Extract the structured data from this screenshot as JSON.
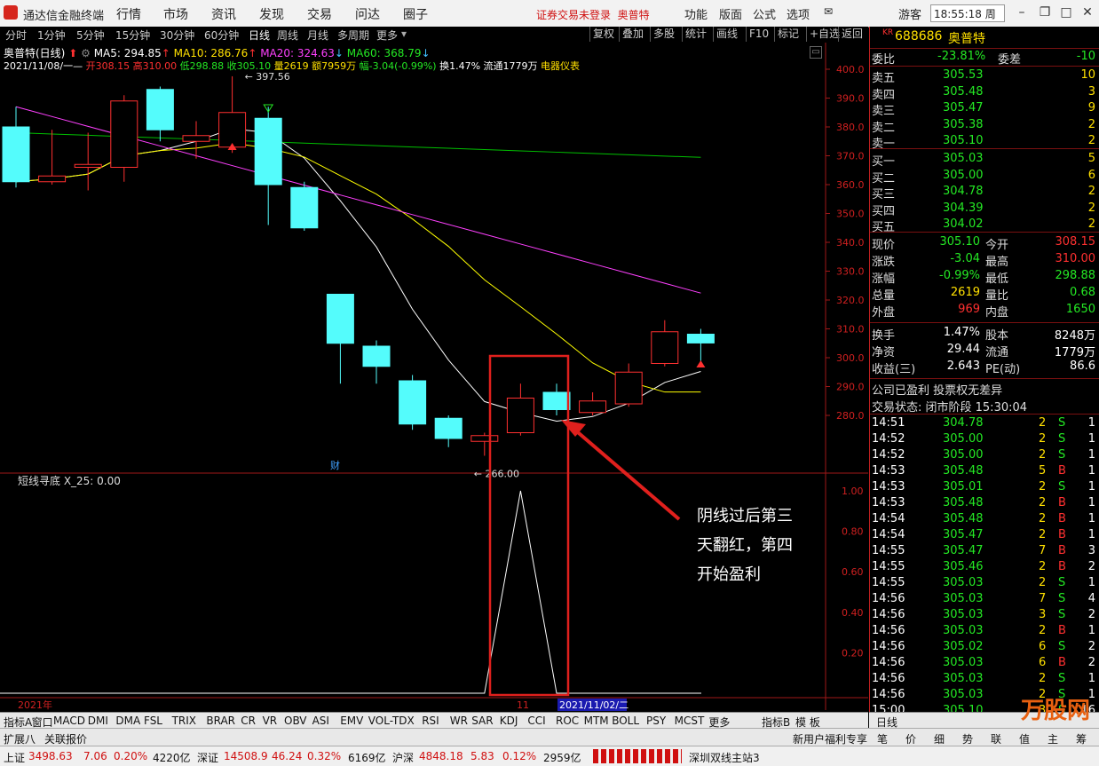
{
  "menubar": {
    "app_title": "通达信金融终端",
    "items": [
      "行情",
      "市场",
      "资讯",
      "发现",
      "交易",
      "问达",
      "圈子"
    ],
    "warning": "证券交易未登录",
    "stock_short": "奥普特",
    "right_items": [
      "功能",
      "版面",
      "公式",
      "选项"
    ],
    "user": "游客",
    "clock": "18:55:18 周一"
  },
  "periods": [
    "分时",
    "1分钟",
    "5分钟",
    "15分钟",
    "30分钟",
    "60分钟",
    "日线",
    "周线",
    "月线",
    "多周期",
    "更多"
  ],
  "active_period": "日线",
  "tool_buttons": [
    "复权",
    "叠加",
    "多股",
    "统计",
    "画线",
    "F10",
    "标记",
    "+自选",
    "返回"
  ],
  "chart_header": {
    "name": "奥普特(日线)",
    "ma5": "MA5: 294.85",
    "ma10": "MA10: 286.76",
    "ma20": "MA20: 324.63",
    "ma60": "MA60: 368.79",
    "line2_date": "2021/11/08/一",
    "line2_open": "开308.15",
    "line2_high": "高310.00",
    "line2_low": "低298.88",
    "line2_close": "收305.10",
    "line2_vol": "量2619",
    "line2_amt": "额7959万",
    "line2_chg": "幅-3.04(-0.99%)",
    "line2_turn": "换1.47%",
    "line2_float": "流通1779万",
    "line2_sector": "电器仪表"
  },
  "price_axis": [
    "400.0",
    "390.0",
    "380.0",
    "370.0",
    "360.0",
    "350.0",
    "340.0",
    "330.0",
    "320.0",
    "310.0",
    "300.0",
    "290.0",
    "280.0"
  ],
  "high_label": "397.56",
  "low_label": "266.00",
  "cai_label": "财",
  "indicator": {
    "title": "短线寻底 X_25: 0.00",
    "axis": [
      "1.00",
      "0.80",
      "0.60",
      "0.40",
      "0.20"
    ]
  },
  "date_axis": {
    "start": "2021年",
    "mid": "11",
    "cursor": "2021/11/02/二"
  },
  "annotation": {
    "line1": "阴线过后第三",
    "line2": "天翻红，第四",
    "line3": "开始盈利"
  },
  "chart_data": {
    "type": "candlestick",
    "candles": [
      {
        "o": 380.0,
        "h": 387.0,
        "l": 359.0,
        "c": 361.0
      },
      {
        "o": 361.0,
        "h": 379.0,
        "l": 360.0,
        "c": 363.0
      },
      {
        "o": 366.0,
        "h": 378.0,
        "l": 358.0,
        "c": 367.0
      },
      {
        "o": 366.0,
        "h": 391.0,
        "l": 361.0,
        "c": 389.0
      },
      {
        "o": 393.0,
        "h": 394.0,
        "l": 375.0,
        "c": 379.0
      },
      {
        "o": 375.0,
        "h": 382.0,
        "l": 369.0,
        "c": 377.0
      },
      {
        "o": 373.0,
        "h": 397.56,
        "l": 371.0,
        "c": 385.0
      },
      {
        "o": 383.0,
        "h": 387.0,
        "l": 346.0,
        "c": 360.0
      },
      {
        "o": 359.0,
        "h": 361.0,
        "l": 344.0,
        "c": 345.0
      },
      {
        "o": 322.0,
        "h": 322.0,
        "l": 291.0,
        "c": 305.0
      },
      {
        "o": 304.0,
        "h": 306.0,
        "l": 291.0,
        "c": 297.0
      },
      {
        "o": 292.0,
        "h": 294.0,
        "l": 275.0,
        "c": 277.0
      },
      {
        "o": 279.0,
        "h": 280.0,
        "l": 269.0,
        "c": 272.0
      },
      {
        "o": 271.0,
        "h": 274.0,
        "l": 266.0,
        "c": 273.0
      },
      {
        "o": 274.0,
        "h": 291.0,
        "l": 273.0,
        "c": 286.0
      },
      {
        "o": 288.0,
        "h": 291.0,
        "l": 280.0,
        "c": 282.0
      },
      {
        "o": 281.0,
        "h": 288.0,
        "l": 280.0,
        "c": 285.0
      },
      {
        "o": 284.0,
        "h": 298.0,
        "l": 283.0,
        "c": 295.0
      },
      {
        "o": 298.0,
        "h": 313.0,
        "l": 297.0,
        "c": 309.0
      },
      {
        "o": 308.15,
        "h": 310.0,
        "l": 298.88,
        "c": 305.1
      }
    ],
    "ylim": [
      266,
      402
    ],
    "indicator_values": [
      0,
      0,
      0,
      0,
      0,
      0,
      0,
      0,
      0,
      0,
      0,
      0,
      0,
      0,
      1,
      0,
      0,
      0,
      0,
      0
    ]
  },
  "quote": {
    "code_prefix": "KR",
    "code": "688686",
    "name": "奥普特",
    "weibi_label": "委比",
    "weibi": "-23.81%",
    "weicha_label": "委差",
    "weicha": "-10",
    "asks": [
      {
        "label": "卖五",
        "price": "305.53",
        "vol": "10"
      },
      {
        "label": "卖四",
        "price": "305.48",
        "vol": "3"
      },
      {
        "label": "卖三",
        "price": "305.47",
        "vol": "9"
      },
      {
        "label": "卖二",
        "price": "305.38",
        "vol": "2"
      },
      {
        "label": "卖一",
        "price": "305.10",
        "vol": "2"
      }
    ],
    "bids": [
      {
        "label": "买一",
        "price": "305.03",
        "vol": "5"
      },
      {
        "label": "买二",
        "price": "305.00",
        "vol": "6"
      },
      {
        "label": "买三",
        "price": "304.78",
        "vol": "2"
      },
      {
        "label": "买四",
        "price": "304.39",
        "vol": "2"
      },
      {
        "label": "买五",
        "price": "304.02",
        "vol": "2"
      }
    ],
    "stats": [
      {
        "l1": "现价",
        "v1": "305.10",
        "c1": "grn",
        "l2": "今开",
        "v2": "308.15",
        "c2": "red"
      },
      {
        "l1": "涨跌",
        "v1": "-3.04",
        "c1": "grn",
        "l2": "最高",
        "v2": "310.00",
        "c2": "red"
      },
      {
        "l1": "涨幅",
        "v1": "-0.99%",
        "c1": "grn",
        "l2": "最低",
        "v2": "298.88",
        "c2": "grn"
      },
      {
        "l1": "总量",
        "v1": "2619",
        "c1": "yel",
        "l2": "量比",
        "v2": "0.68",
        "c2": "grn"
      },
      {
        "l1": "外盘",
        "v1": "969",
        "c1": "red",
        "l2": "内盘",
        "v2": "1650",
        "c2": "grn"
      }
    ],
    "stats2": [
      {
        "l1": "换手",
        "v1": "1.47%",
        "l2": "股本",
        "v2": "8248万"
      },
      {
        "l1": "净资",
        "v1": "29.44",
        "l2": "流通",
        "v2": "1779万"
      },
      {
        "l1": "收益(三)",
        "v1": "2.643",
        "l2": "PE(动)",
        "v2": "86.6"
      }
    ],
    "company_status": "公司已盈利 投票权无差异",
    "trade_status": "交易状态: 闭市阶段 15:30:04"
  },
  "ticks": [
    {
      "t": "14:51",
      "p": "304.78",
      "v": "2",
      "s": "S",
      "n": "1"
    },
    {
      "t": "14:52",
      "p": "305.00",
      "v": "2",
      "s": "S",
      "n": "1"
    },
    {
      "t": "14:52",
      "p": "305.00",
      "v": "2",
      "s": "S",
      "n": "1"
    },
    {
      "t": "14:53",
      "p": "305.48",
      "v": "5",
      "s": "B",
      "n": "1"
    },
    {
      "t": "14:53",
      "p": "305.01",
      "v": "2",
      "s": "S",
      "n": "1"
    },
    {
      "t": "14:53",
      "p": "305.48",
      "v": "2",
      "s": "B",
      "n": "1"
    },
    {
      "t": "14:54",
      "p": "305.48",
      "v": "2",
      "s": "B",
      "n": "1"
    },
    {
      "t": "14:54",
      "p": "305.47",
      "v": "2",
      "s": "B",
      "n": "1"
    },
    {
      "t": "14:55",
      "p": "305.47",
      "v": "7",
      "s": "B",
      "n": "3"
    },
    {
      "t": "14:55",
      "p": "305.46",
      "v": "2",
      "s": "B",
      "n": "2"
    },
    {
      "t": "14:55",
      "p": "305.03",
      "v": "2",
      "s": "S",
      "n": "1"
    },
    {
      "t": "14:56",
      "p": "305.03",
      "v": "7",
      "s": "S",
      "n": "4"
    },
    {
      "t": "14:56",
      "p": "305.03",
      "v": "3",
      "s": "S",
      "n": "2"
    },
    {
      "t": "14:56",
      "p": "305.03",
      "v": "2",
      "s": "B",
      "n": "1"
    },
    {
      "t": "14:56",
      "p": "305.02",
      "v": "6",
      "s": "S",
      "n": "2"
    },
    {
      "t": "14:56",
      "p": "305.03",
      "v": "6",
      "s": "B",
      "n": "2"
    },
    {
      "t": "14:56",
      "p": "305.03",
      "v": "2",
      "s": "S",
      "n": "1"
    },
    {
      "t": "14:56",
      "p": "305.03",
      "v": "2",
      "s": "S",
      "n": "1"
    },
    {
      "t": "15:00",
      "p": "305.10",
      "v": "3",
      "s": "S",
      "n": "16"
    }
  ],
  "indicator_tabs": [
    "指标A",
    "窗口",
    "MACD",
    "DMI",
    "DMA",
    "FSL",
    "TRIX",
    "BRAR",
    "CR",
    "VR",
    "OBV",
    "ASI",
    "EMV",
    "VOL-TDX",
    "RSI",
    "WR",
    "SAR",
    "KDJ",
    "CCI",
    "ROC",
    "MTM",
    "BOLL",
    "PSY",
    "MCST",
    "更多"
  ],
  "indicator_tabs_right": [
    "指标B",
    "模 板"
  ],
  "right_tab": "日线",
  "bar3_left": [
    "扩展八",
    "关联报价"
  ],
  "bar3_right": [
    "新用户福利专享",
    "笔",
    "价",
    "细",
    "势",
    "联",
    "值",
    "主",
    "筹"
  ],
  "status": {
    "sh_label": "上证",
    "sh_val": "3498.63",
    "sh_chg": "7.06",
    "sh_pct": "0.20%",
    "sh_amt": "4220亿",
    "sz_label": "深证",
    "sz_val": "14508.9",
    "sz_chg": "46.24",
    "sz_pct": "0.32%",
    "sz_amt": "6169亿",
    "hs_label": "沪深",
    "hs_val": "4848.18",
    "hs_chg": "5.83",
    "hs_pct": "0.12%",
    "hs_amt": "2959亿",
    "server": "深圳双线主站3"
  },
  "watermark": "万股网",
  "colors": {
    "up": "#ff3030",
    "down": "#54fcfc",
    "ma5": "#ffffff",
    "ma10": "#ffff00",
    "ma20": "#ff40ff",
    "ma60": "#00c000",
    "accent": "#ff2020"
  }
}
